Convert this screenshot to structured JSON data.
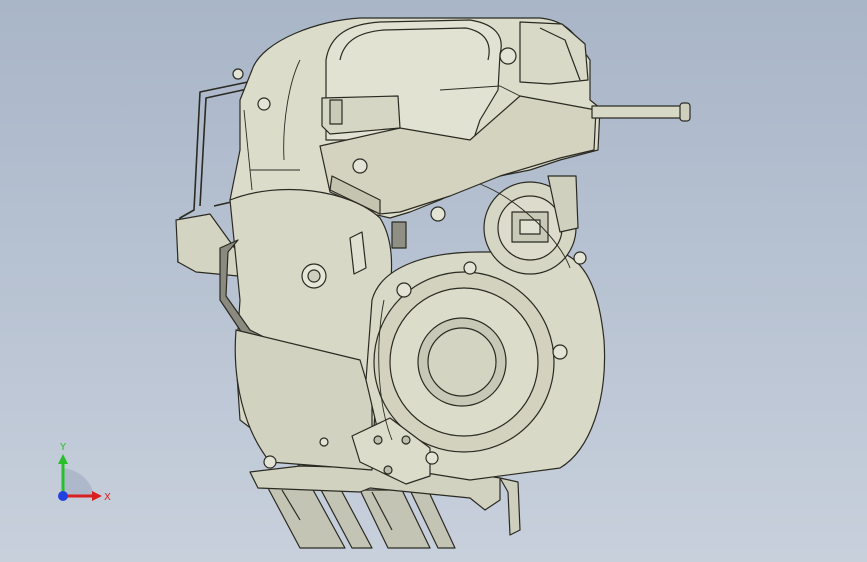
{
  "viewport": {
    "background_top": "#a9b6c8",
    "background_bottom": "#c8d0dc"
  },
  "model": {
    "body_fill": "#dcdccb",
    "body_dark": "#c9c9b6",
    "edge": "#2a2a22",
    "duct_fill": "#bfbfb0"
  },
  "triad": {
    "x_label": "X",
    "y_label": "Y",
    "x_color": "#d92020",
    "y_color": "#28c028",
    "z_color": "#2040e0"
  }
}
